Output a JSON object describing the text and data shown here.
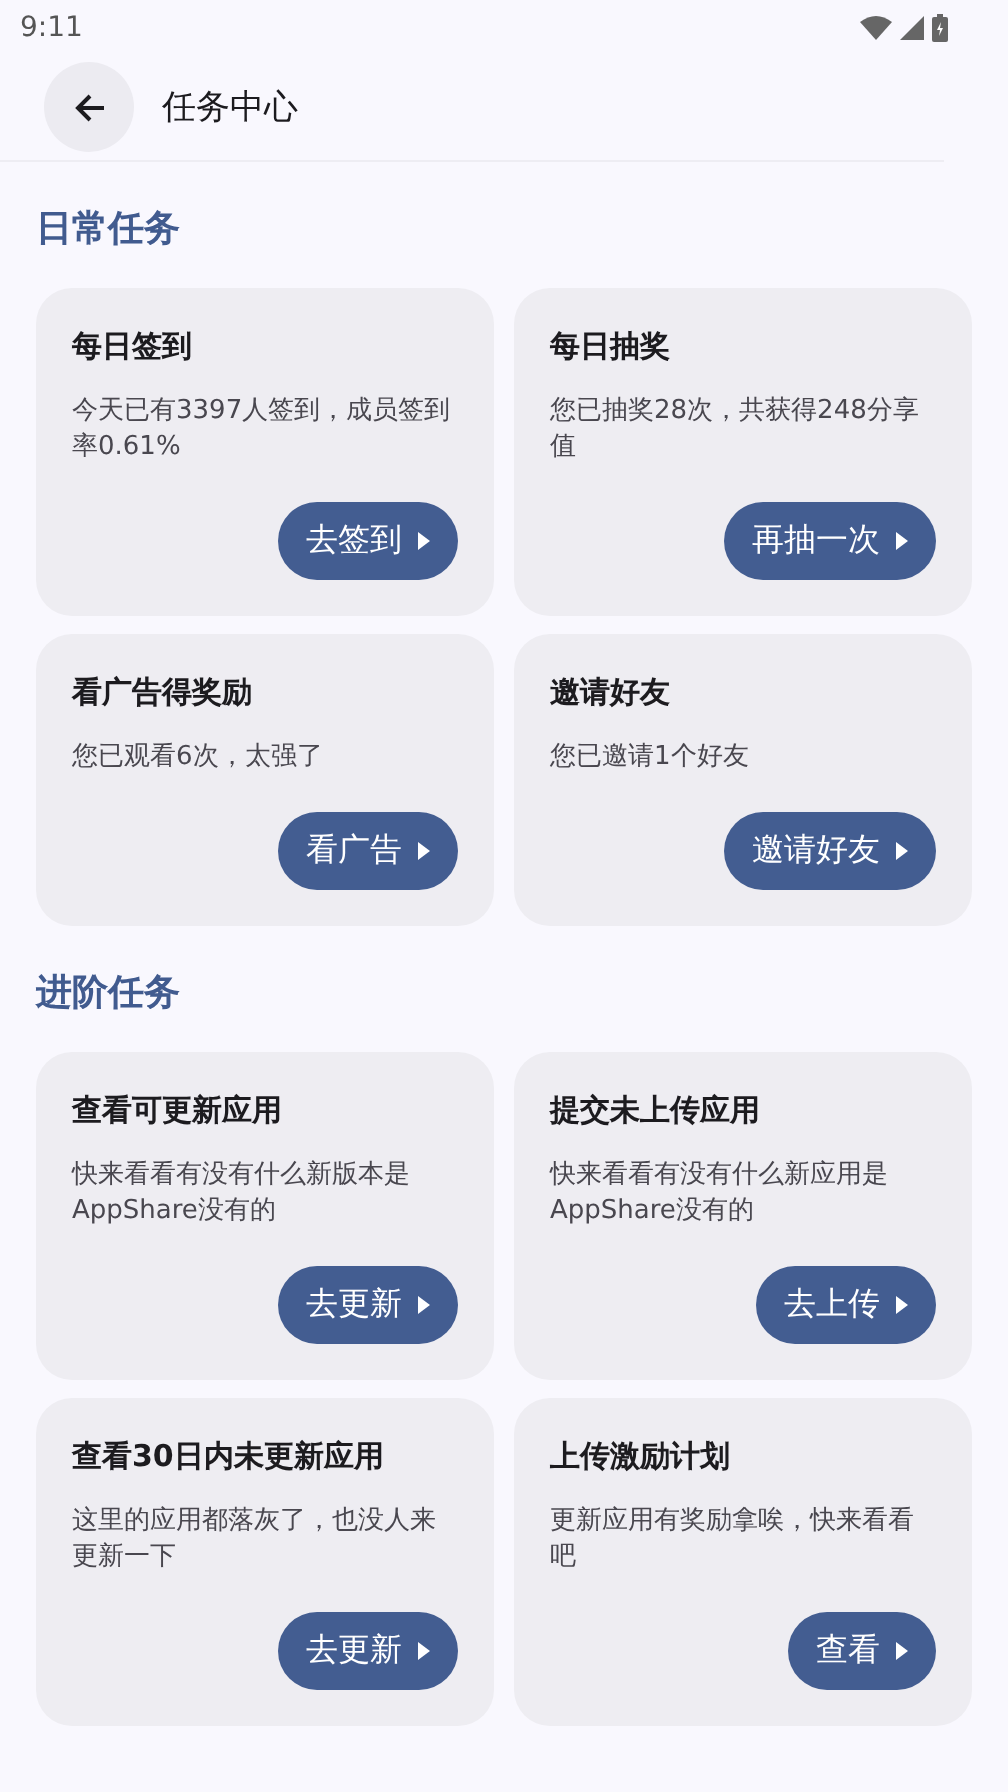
{
  "status_bar": {
    "time": "9:11"
  },
  "header": {
    "title": "任务中心"
  },
  "sections": [
    {
      "title": "日常任务",
      "tasks": [
        {
          "title": "每日签到",
          "description": "今天已有3397人签到，成员签到率0.61%",
          "action": "去签到"
        },
        {
          "title": "每日抽奖",
          "description": "您已抽奖28次，共获得248分享值",
          "action": "再抽一次"
        },
        {
          "title": "看广告得奖励",
          "description": "您已观看6次，太强了",
          "action": "看广告"
        },
        {
          "title": "邀请好友",
          "description": "您已邀请1个好友",
          "action": "邀请好友"
        }
      ]
    },
    {
      "title": "进阶任务",
      "tasks": [
        {
          "title": "查看可更新应用",
          "description": "快来看看有没有什么新版本是AppShare没有的",
          "action": "去更新"
        },
        {
          "title": "提交未上传应用",
          "description": "快来看看有没有什么新应用是AppShare没有的",
          "action": "去上传"
        },
        {
          "title": "查看30日内未更新应用",
          "description": "这里的应用都落灰了，也没人来更新一下",
          "action": "去更新"
        },
        {
          "title": "上传激励计划",
          "description": "更新应用有奖励拿唉，快来看看吧",
          "action": "查看"
        }
      ]
    }
  ]
}
